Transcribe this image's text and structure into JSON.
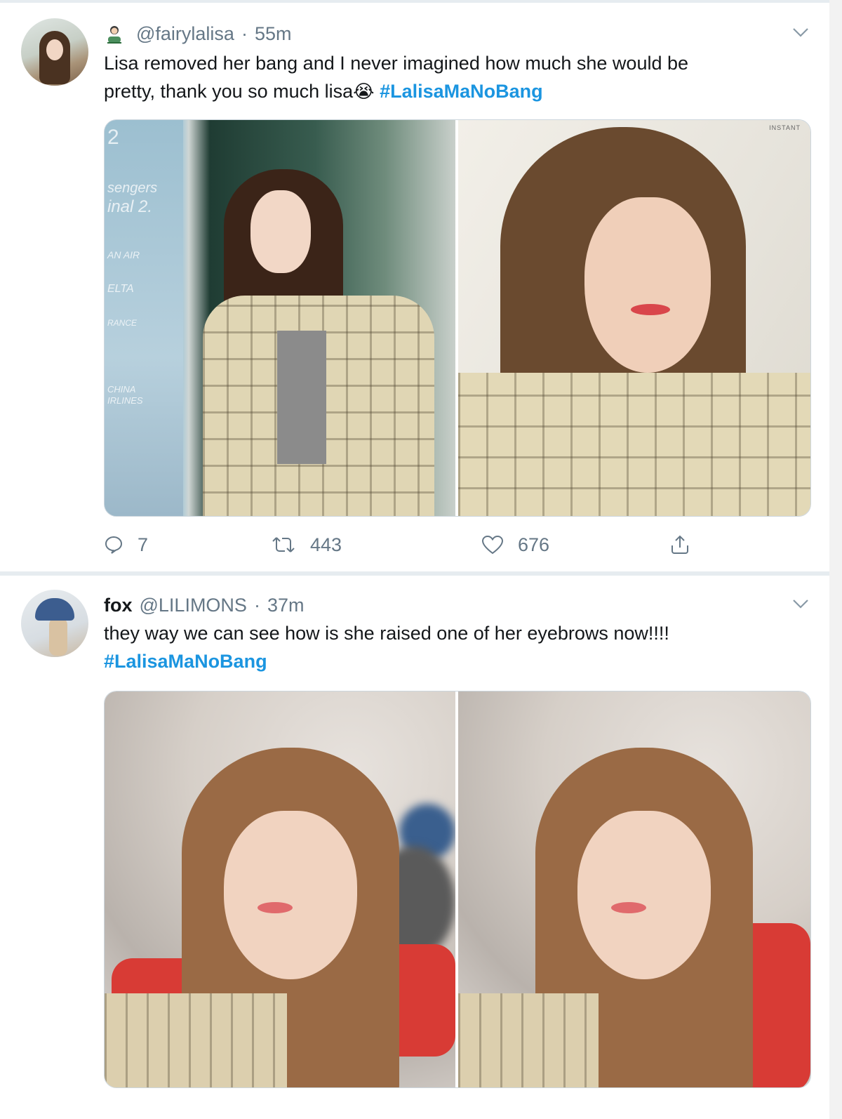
{
  "tweets": [
    {
      "display_name": "",
      "handle": "@fairylalisa",
      "separator": "·",
      "time": "55m",
      "text_line1": "Lisa removed her bang and I never imagined how much she would be",
      "text_line2": "pretty, thank you so much lisa",
      "emoji": "😭",
      "hashtag": "#LalisaMaNoBang",
      "replies": "7",
      "retweets": "443",
      "likes": "676"
    },
    {
      "display_name": "fox",
      "handle": "@LILIMONS",
      "separator": "·",
      "time": "37m",
      "text_line1": "they way we can see how is she raised one of her eyebrows now!!!!",
      "hashtag": "#LalisaMaNoBang"
    }
  ],
  "photo_text": {
    "sign_lines": [
      "2",
      "sengers",
      "inal 2.",
      "AN AIR",
      "ELTA",
      "RANCE",
      "CHINA",
      "IRLINES"
    ],
    "watermark": "INSTANT"
  },
  "icons": {
    "user_icon": "user-avatar-icon",
    "chevron": "chevron-down-icon",
    "reply": "reply-icon",
    "retweet": "retweet-icon",
    "like": "heart-icon",
    "share": "share-icon"
  },
  "colors": {
    "hashtag": "#1b95e0",
    "secondary_text": "#657786",
    "divider": "#e6ecf0"
  }
}
